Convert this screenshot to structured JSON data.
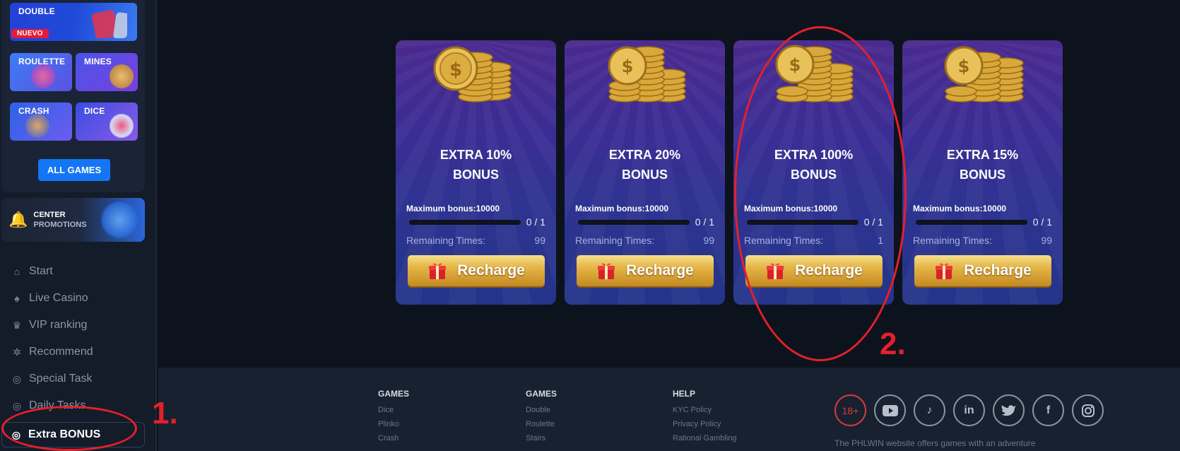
{
  "sidebar": {
    "games": {
      "double": {
        "label": "DOUBLE",
        "badge": "NUEVO"
      },
      "roulette": {
        "label": "ROULETTE"
      },
      "mines": {
        "label": "MINES"
      },
      "crash": {
        "label": "CRASH"
      },
      "dice": {
        "label": "DICE"
      },
      "all_games": "ALL GAMES"
    },
    "promo": {
      "line1": "CENTER",
      "line2": "PROMOTIONS",
      "icon": "bell-icon"
    },
    "nav": [
      {
        "label": "Start",
        "icon": "home-icon"
      },
      {
        "label": "Live Casino",
        "icon": "casino-icon"
      },
      {
        "label": "VIP ranking",
        "icon": "crown-icon"
      },
      {
        "label": "Recommend",
        "icon": "share-icon"
      },
      {
        "label": "Special Task",
        "icon": "target-icon"
      },
      {
        "label": "Daily Tasks",
        "icon": "calendar-icon"
      },
      {
        "label": "Extra BONUS",
        "icon": "bonus-icon",
        "active": true
      }
    ]
  },
  "bonus_cards": [
    {
      "title_line1": "EXTRA 10%",
      "title_line2": "BONUS",
      "max_bonus": "Maximum bonus:10000",
      "progress_text": "0 / 1",
      "progress": 0,
      "remaining_label": "Remaining Times:",
      "remaining_value": "99",
      "button": "Recharge"
    },
    {
      "title_line1": "EXTRA 20%",
      "title_line2": "BONUS",
      "max_bonus": "Maximum bonus:10000",
      "progress_text": "0 / 1",
      "progress": 0,
      "remaining_label": "Remaining Times:",
      "remaining_value": "99",
      "button": "Recharge"
    },
    {
      "title_line1": "EXTRA 100%",
      "title_line2": "BONUS",
      "max_bonus": "Maximum bonus:10000",
      "progress_text": "0 / 1",
      "progress": 0,
      "remaining_label": "Remaining Times:",
      "remaining_value": "1",
      "button": "Recharge"
    },
    {
      "title_line1": "EXTRA 15%",
      "title_line2": "BONUS",
      "max_bonus": "Maximum bonus:10000",
      "progress_text": "0 / 1",
      "progress": 0,
      "remaining_label": "Remaining Times:",
      "remaining_value": "99",
      "button": "Recharge"
    }
  ],
  "annotations": {
    "step1": "1.",
    "step2": "2.",
    "color": "#e5202b"
  },
  "footer": {
    "columns": [
      {
        "title": "GAMES",
        "links": [
          "Dice",
          "Plinko",
          "Crash"
        ]
      },
      {
        "title": "GAMES",
        "links": [
          "Double",
          "Roulette",
          "Stairs"
        ]
      },
      {
        "title": "HELP",
        "links": [
          "KYC Policy",
          "Privacy Policy",
          "Rational Gambling"
        ]
      }
    ],
    "socials": [
      {
        "label": "18+",
        "icon": "age-restriction-icon"
      },
      {
        "label": "",
        "icon": "youtube-icon"
      },
      {
        "label": "",
        "icon": "tiktok-icon"
      },
      {
        "label": "in",
        "icon": "linkedin-icon"
      },
      {
        "label": "",
        "icon": "twitter-icon"
      },
      {
        "label": "f",
        "icon": "facebook-icon"
      },
      {
        "label": "",
        "icon": "instagram-icon"
      }
    ],
    "text": "The PHLWIN website offers games with an adventure"
  },
  "colors": {
    "accent": "#1476f4",
    "gold": "#e4b445",
    "card_purple": "#3b2d94",
    "annotation_red": "#e5202b"
  }
}
